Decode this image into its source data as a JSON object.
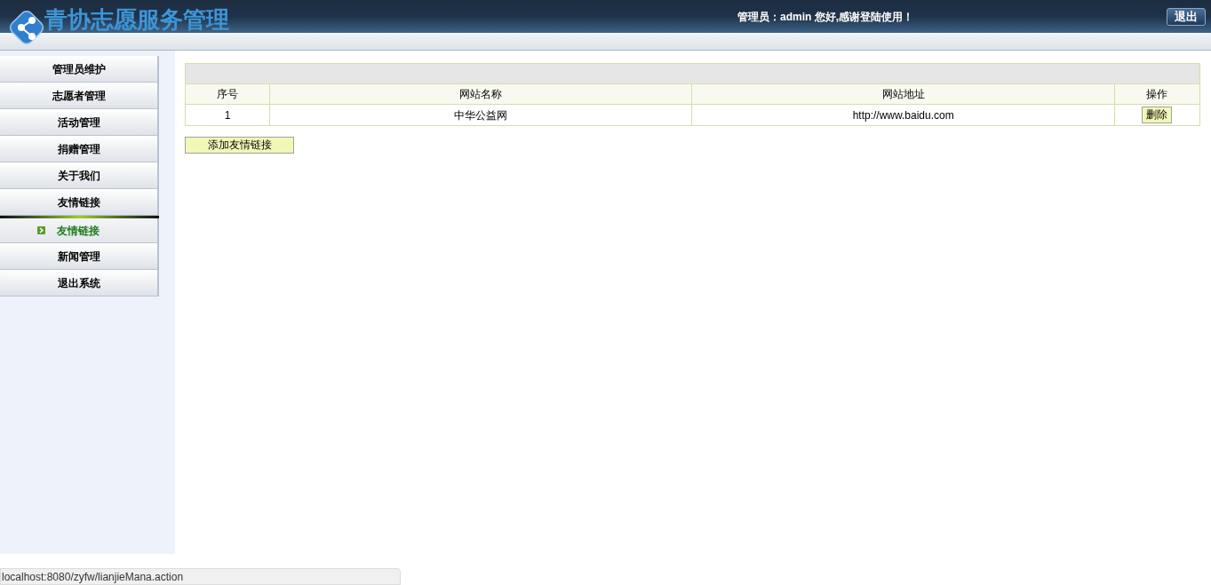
{
  "header": {
    "title": "青协志愿服务管理",
    "greeting": "管理员：admin 您好,感谢登陆使用！",
    "logout_button": "退出"
  },
  "sidebar": {
    "items": [
      {
        "label": "管理员维护",
        "expanded": false
      },
      {
        "label": "志愿者管理",
        "expanded": false
      },
      {
        "label": "活动管理",
        "expanded": false
      },
      {
        "label": "捐赠管理",
        "expanded": false
      },
      {
        "label": "关于我们",
        "expanded": false
      },
      {
        "label": "友情链接",
        "expanded": true,
        "children": [
          {
            "label": "友情链接",
            "selected": true
          }
        ]
      },
      {
        "label": "新闻管理",
        "expanded": false
      },
      {
        "label": "退出系统",
        "expanded": false
      }
    ]
  },
  "table": {
    "columns": [
      "序号",
      "网站名称",
      "网站地址",
      "操作"
    ],
    "rows": [
      {
        "index": "1",
        "name": "中华公益网",
        "url": "http://www.baidu.com",
        "action": "删除"
      }
    ]
  },
  "add_button": "添加友情链接",
  "status_bar": "localhost:8080/zyfw/lianjieMana.action"
}
